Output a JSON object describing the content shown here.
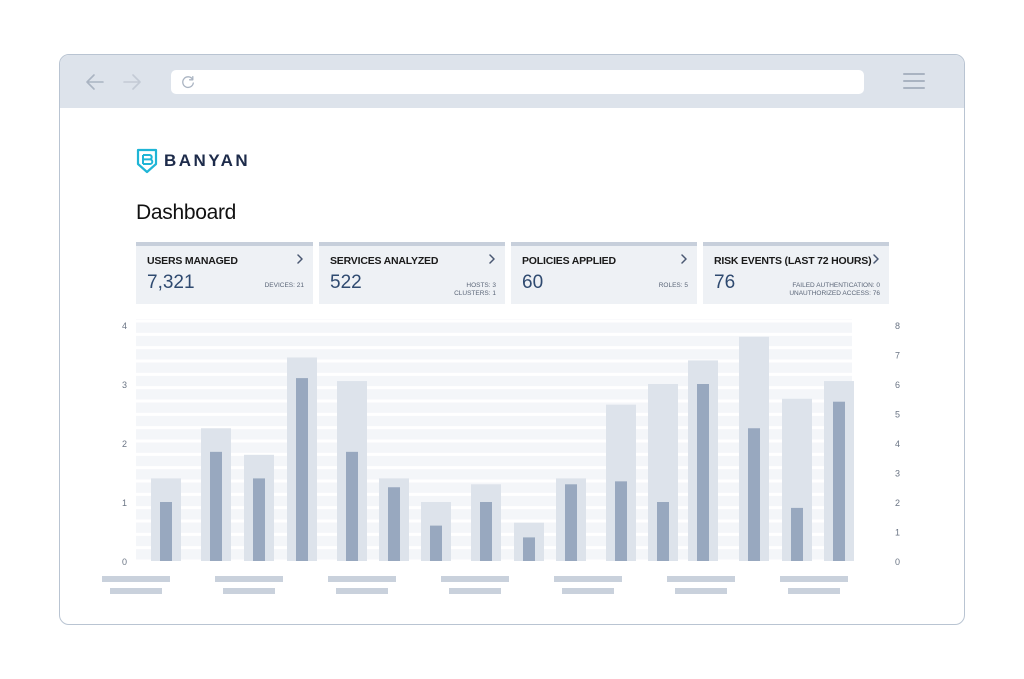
{
  "app": {
    "logo_text": "BANYAN",
    "page_title": "Dashboard"
  },
  "icons": {
    "back": "arrow-left-icon",
    "forward": "arrow-right-icon",
    "reload": "reload-icon",
    "menu": "hamburger-menu-icon",
    "logo": "banyan-shield-logo-icon",
    "card_open": "chevron-right-icon"
  },
  "colors": {
    "toolbar": "#dde3eb",
    "card_bg": "#eef1f5",
    "card_accent": "#c7cfdb",
    "value_text": "#2f4a70",
    "logo_teal": "#1fb5d6",
    "bar_back": "#dde3eb",
    "bar_front": "#98a8bf",
    "gridline": "#e9edf2"
  },
  "cards": [
    {
      "title": "USERS MANAGED",
      "value": "7,321",
      "details": [
        "DEVICES: 21"
      ]
    },
    {
      "title": "SERVICES ANALYZED",
      "value": "522",
      "details": [
        "HOSTS: 3",
        "CLUSTERS: 1"
      ]
    },
    {
      "title": "POLICIES APPLIED",
      "value": "60",
      "details": [
        "ROLES: 5"
      ]
    },
    {
      "title": "RISK EVENTS (LAST 72 HOURS)",
      "value": "76",
      "details": [
        "FAILED AUTHENTICATION: 0",
        "UNAUTHORIZED ACCESS: 76"
      ]
    }
  ],
  "chart_data": {
    "type": "bar",
    "left_axis": {
      "ticks": [
        "0",
        "1",
        "2",
        "3",
        "4"
      ],
      "range": [
        0,
        4
      ]
    },
    "right_axis": {
      "ticks": [
        "0",
        "1",
        "2",
        "3",
        "4",
        "5",
        "6",
        "7",
        "8"
      ],
      "range": [
        0,
        8
      ]
    },
    "grid": true,
    "category_labels_shown_as_placeholders": 7,
    "series": [
      {
        "axis": "left",
        "values": [
          1.4,
          2.25,
          1.8,
          3.45,
          3.05,
          1.4,
          1.0,
          1.3,
          0.65,
          1.4,
          2.65,
          3.0,
          3.4,
          3.8,
          2.75,
          3.05
        ]
      },
      {
        "axis": "left",
        "values": [
          1.0,
          1.85,
          1.4,
          3.1,
          1.85,
          1.25,
          0.6,
          1.0,
          0.4,
          1.3,
          1.35,
          1.0,
          3.0,
          2.25,
          0.9,
          2.7
        ]
      }
    ]
  }
}
